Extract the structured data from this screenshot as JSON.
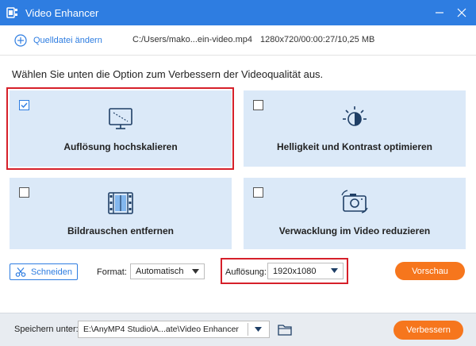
{
  "window": {
    "title": "Video Enhancer",
    "minimize_icon": "minimize-icon",
    "close_icon": "close-icon"
  },
  "source": {
    "add_label": "Quelldatei ändern",
    "file_path": "C:/Users/mako...ein-video.mp4",
    "file_meta": "1280x720/00:00:27/10,25 MB"
  },
  "instruction": "Wählen Sie unten die Option zum Verbessern der Videoqualität aus.",
  "options": [
    {
      "label": "Auflösung hochskalieren",
      "checked": true,
      "icon": "monitor-upscale-icon"
    },
    {
      "label": "Helligkeit und Kontrast optimieren",
      "checked": false,
      "icon": "brightness-icon"
    },
    {
      "label": "Bildrauschen entfernen",
      "checked": false,
      "icon": "film-noise-icon"
    },
    {
      "label": "Verwacklung im Video reduzieren",
      "checked": false,
      "icon": "camera-shake-icon"
    }
  ],
  "controls": {
    "cut_label": "Schneiden",
    "format_label": "Format:",
    "format_value": "Automatisch",
    "resolution_label": "Auflösung:",
    "resolution_value": "1920x1080",
    "preview_label": "Vorschau"
  },
  "footer": {
    "save_label": "Speichern unter:",
    "save_path": "E:\\AnyMP4 Studio\\A...ate\\Video Enhancer",
    "enhance_label": "Verbessern"
  },
  "colors": {
    "accent": "#2e7de1",
    "card_bg": "#dbe9f8",
    "highlight": "#d6202a",
    "orange": "#f6761d"
  }
}
